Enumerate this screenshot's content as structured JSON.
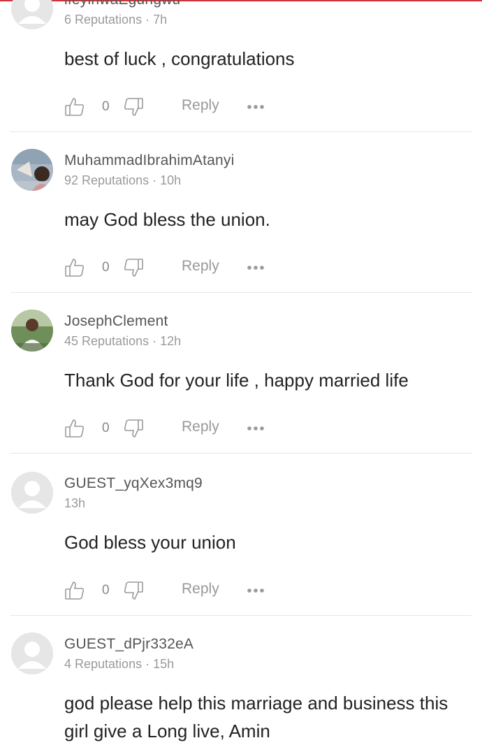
{
  "comments": [
    {
      "name": "ifeyinwaEgungwu",
      "meta": "6 Reputations · 7h",
      "text": "best of luck , congratulations",
      "likes": "0",
      "reply": "Reply"
    },
    {
      "name": "MuhammadIbrahimAtanyi",
      "meta": "92 Reputations · 10h",
      "text": "may God bless the union.",
      "likes": "0",
      "reply": "Reply"
    },
    {
      "name": "JosephClement",
      "meta": "45 Reputations · 12h",
      "text": "Thank God for your life , happy married life",
      "likes": "0",
      "reply": "Reply"
    },
    {
      "name": "GUEST_yqXex3mq9",
      "meta": "13h",
      "text": "God bless your union",
      "likes": "0",
      "reply": "Reply"
    },
    {
      "name": "GUEST_dPjr332eA",
      "meta": "4 Reputations · 15h",
      "text": "god please help this marriage and business this girl give a Long live, Amin",
      "likes": "",
      "reply": ""
    }
  ],
  "icons": {
    "like": "thumbs-up-icon",
    "dislike": "thumbs-down-icon",
    "more": "more-dots-icon",
    "avatar_default": "default-avatar-icon"
  },
  "colors": {
    "accent": "#d0343a",
    "username": "#555555",
    "meta": "#9a9a9a",
    "text": "#222222",
    "action": "#999999"
  }
}
